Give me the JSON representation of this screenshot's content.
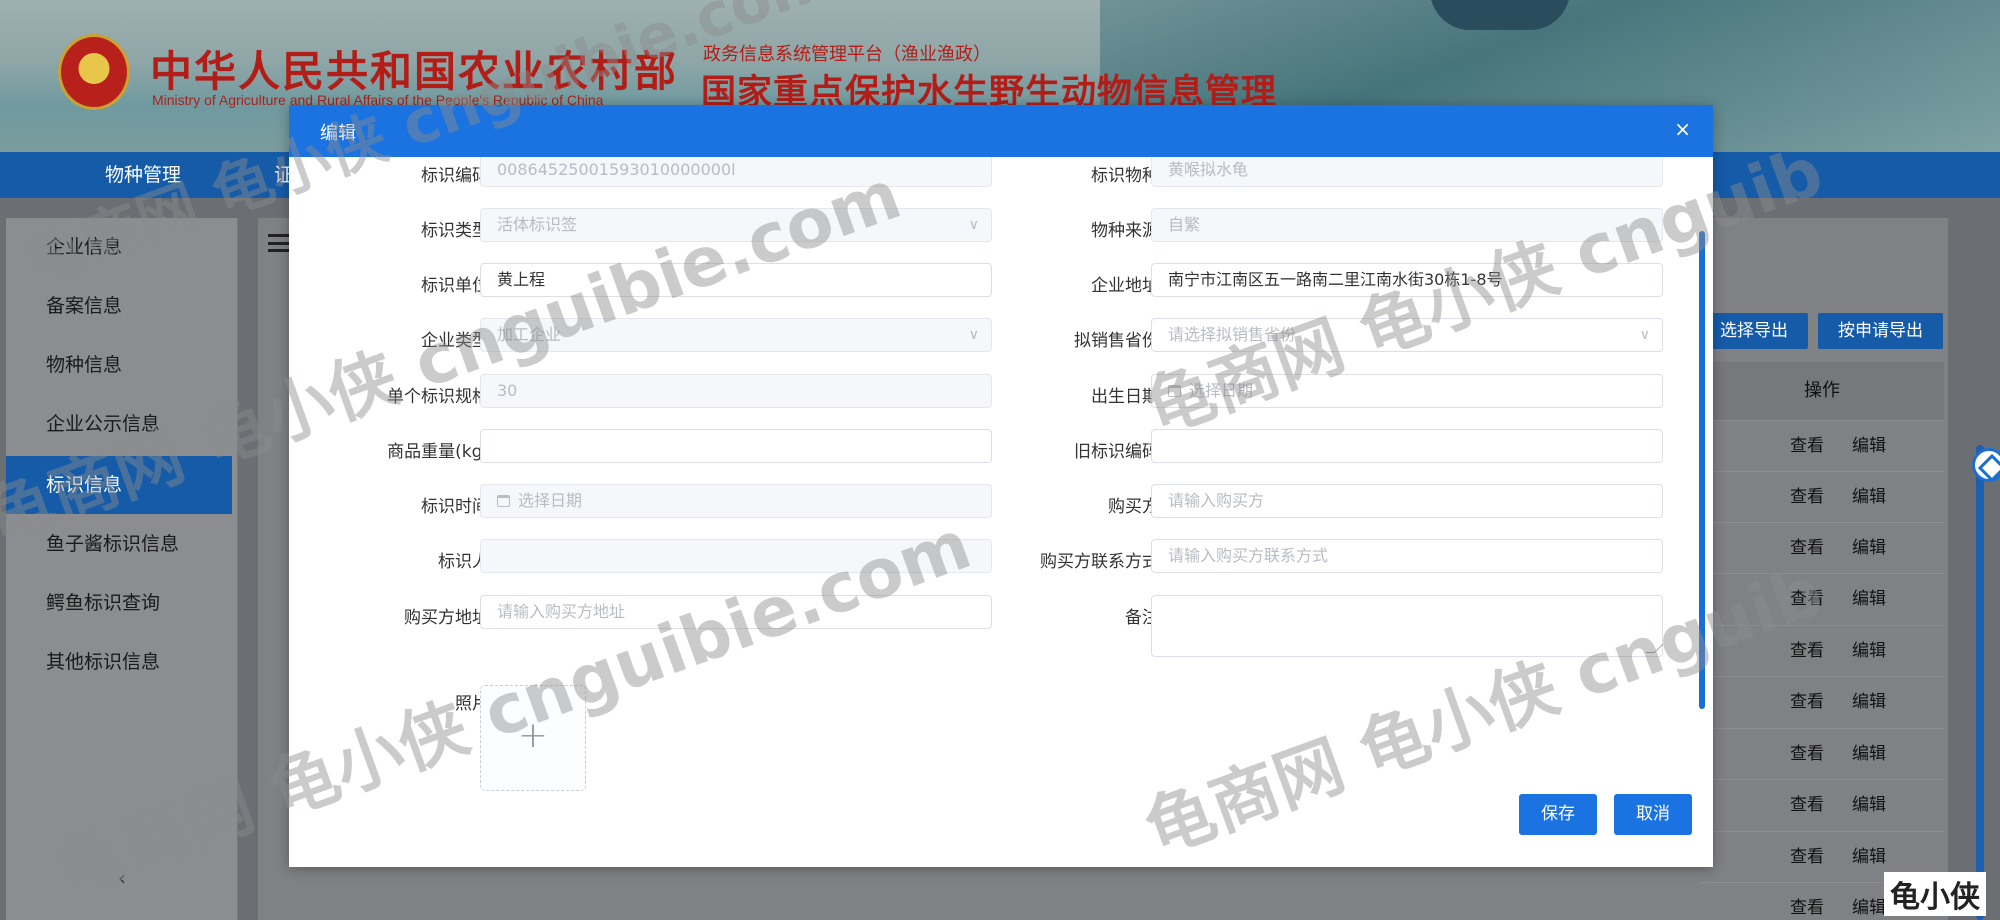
{
  "header": {
    "ministry_cn": "中华人民共和国农业农村部",
    "ministry_en": "Ministry of Agriculture and Rural Affairs of the People's Republic of China",
    "platform_subtitle": "政务信息系统管理平台（渔业渔政）",
    "platform_title": "国家重点保护水生野生动物信息管理"
  },
  "nav": {
    "items": [
      "物种管理",
      "证"
    ]
  },
  "sidebar": {
    "items": [
      {
        "label": "企业信息",
        "active": false
      },
      {
        "label": "备案信息",
        "active": false
      },
      {
        "label": "物种信息",
        "active": false
      },
      {
        "label": "企业公示信息",
        "active": false
      },
      {
        "label": "标识信息",
        "active": true
      },
      {
        "label": "鱼子酱标识信息",
        "active": false
      },
      {
        "label": "鳄鱼标识查询",
        "active": false
      },
      {
        "label": "其他标识信息",
        "active": false
      }
    ],
    "collapse_icon": "‹"
  },
  "background": {
    "export_selected": "选择导出",
    "export_by_request": "按申请导出",
    "actions_header": "操作",
    "view": "查看",
    "edit": "编辑"
  },
  "modal": {
    "title": "编辑",
    "close": "×",
    "fields": {
      "tag_code": {
        "label": "标识编码",
        "value": "00864525001593010000000l"
      },
      "tag_species": {
        "label": "标识物种",
        "value": "黄喉拟水龟"
      },
      "tag_type": {
        "label": "标识类型",
        "value": "活体标识签"
      },
      "species_source": {
        "label": "物种来源",
        "value": "自繁"
      },
      "tag_unit": {
        "label": "标识单位",
        "value": "黄上程"
      },
      "company_address": {
        "label": "企业地址",
        "value": "南宁市江南区五一路南二里江南水街30栋1-8号"
      },
      "company_type": {
        "label": "企业类型",
        "value": "加工企业"
      },
      "sale_province": {
        "label": "拟销售省份",
        "placeholder": "请选择拟销售省份"
      },
      "tag_spec": {
        "label": "单个标识规格",
        "value": "30"
      },
      "birth_date": {
        "label": "出生日期",
        "placeholder": "选择日期"
      },
      "weight": {
        "label": "商品重量(kg)",
        "value": ""
      },
      "old_tag_code": {
        "label": "旧标识编码",
        "value": ""
      },
      "tag_time": {
        "label": "标识时间",
        "placeholder": "选择日期"
      },
      "buyer": {
        "label": "购买方",
        "placeholder": "请输入购买方"
      },
      "tagger": {
        "label": "标识人",
        "value": ""
      },
      "buyer_contact": {
        "label": "购买方联系方式",
        "placeholder": "请输入购买方联系方式"
      },
      "buyer_address": {
        "label": "购买方地址",
        "placeholder": "请输入购买方地址"
      },
      "remark": {
        "label": "备注",
        "value": ""
      },
      "photo": {
        "label": "照片",
        "add_icon": "+"
      }
    },
    "save": "保存",
    "cancel": "取消"
  },
  "watermark": {
    "text_a": "龟商网 龟小侠 cnguibie.com",
    "text_b": "龟商网 龟小侠 cnguib",
    "corner": "龟小侠"
  }
}
